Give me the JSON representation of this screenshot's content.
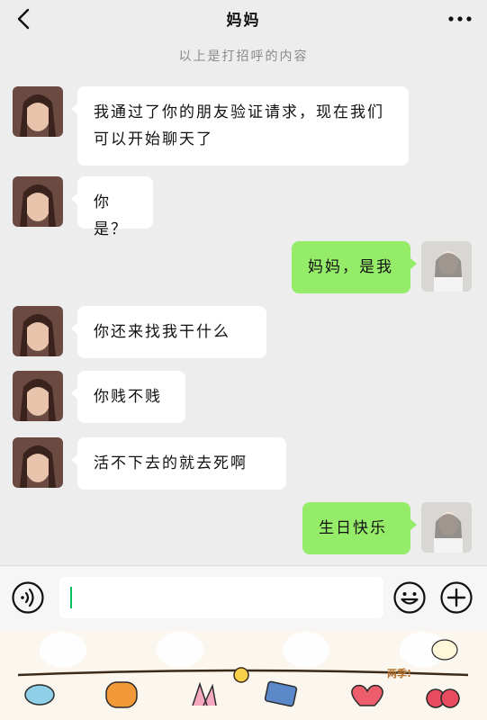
{
  "header": {
    "title": "妈妈",
    "back_icon": "chevron-left-icon",
    "more_icon": "more-dots-icon"
  },
  "system_note": "以上是打招呼的内容",
  "messages": [
    {
      "side": "in",
      "text": "我通过了你的朋友验证请求，现在我们可以开始聊天了"
    },
    {
      "side": "in",
      "text": "你是？"
    },
    {
      "side": "out",
      "text": "妈妈，是我"
    },
    {
      "side": "in",
      "text": "你还来找我干什么"
    },
    {
      "side": "in",
      "text": "你贱不贱"
    },
    {
      "side": "in",
      "text": "活不下去的就去死啊"
    },
    {
      "side": "out",
      "text": "生日快乐"
    }
  ],
  "input_bar": {
    "voice_icon": "voice-icon",
    "text_value": "",
    "emoji_icon": "emoji-icon",
    "plus_icon": "plus-icon"
  },
  "decoration": {
    "label": "两季!"
  },
  "colors": {
    "background": "#ededed",
    "incoming_bubble": "#ffffff",
    "outgoing_bubble": "#95ec69",
    "caret": "#07c160"
  }
}
